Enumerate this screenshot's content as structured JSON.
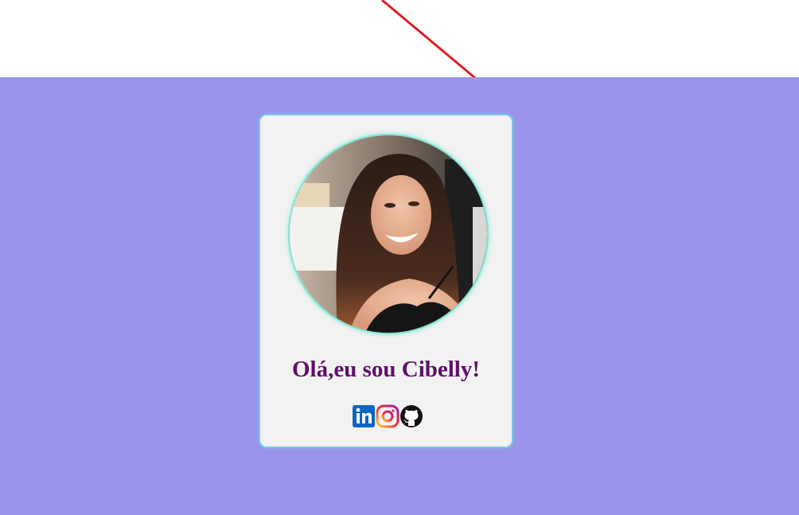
{
  "profile": {
    "greeting": "Olá,eu sou Cibelly!",
    "avatar_alt": "profile-photo"
  },
  "colors": {
    "background": "#9a94ea",
    "card": "#f2f2f2",
    "card_border": "#7ac6e6",
    "greeting": "#5f0f68",
    "annotation_line": "#e01e1e"
  },
  "socials": [
    {
      "name": "linkedin-icon"
    },
    {
      "name": "instagram-icon"
    },
    {
      "name": "github-icon"
    }
  ]
}
